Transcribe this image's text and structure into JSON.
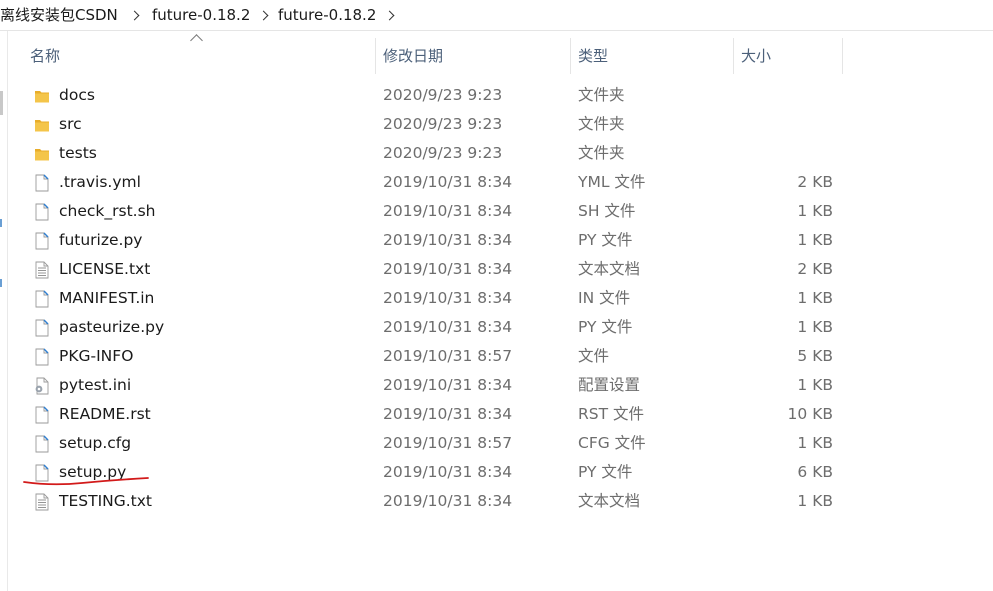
{
  "breadcrumb": {
    "items": [
      "离线安装包CSDN",
      "future-0.18.2",
      "future-0.18.2"
    ]
  },
  "columns": {
    "name": "名称",
    "date": "修改日期",
    "type": "类型",
    "size": "大小"
  },
  "colors": {
    "folder": "#f4c54a",
    "header_text": "#4c607a",
    "annotation": "#d21a1a",
    "doc_accent": "#2f7fd1"
  },
  "files": [
    {
      "name": "docs",
      "date": "2020/9/23 9:23",
      "type": "文件夹",
      "size": "",
      "icon": "folder-icon"
    },
    {
      "name": "src",
      "date": "2020/9/23 9:23",
      "type": "文件夹",
      "size": "",
      "icon": "folder-icon"
    },
    {
      "name": "tests",
      "date": "2020/9/23 9:23",
      "type": "文件夹",
      "size": "",
      "icon": "folder-icon"
    },
    {
      "name": ".travis.yml",
      "date": "2019/10/31 8:34",
      "type": "YML 文件",
      "size": "2 KB",
      "icon": "file-icon"
    },
    {
      "name": "check_rst.sh",
      "date": "2019/10/31 8:34",
      "type": "SH 文件",
      "size": "1 KB",
      "icon": "file-icon"
    },
    {
      "name": "futurize.py",
      "date": "2019/10/31 8:34",
      "type": "PY 文件",
      "size": "1 KB",
      "icon": "file-icon"
    },
    {
      "name": "LICENSE.txt",
      "date": "2019/10/31 8:34",
      "type": "文本文档",
      "size": "2 KB",
      "icon": "text-file-icon"
    },
    {
      "name": "MANIFEST.in",
      "date": "2019/10/31 8:34",
      "type": "IN 文件",
      "size": "1 KB",
      "icon": "file-icon"
    },
    {
      "name": "pasteurize.py",
      "date": "2019/10/31 8:34",
      "type": "PY 文件",
      "size": "1 KB",
      "icon": "file-icon"
    },
    {
      "name": "PKG-INFO",
      "date": "2019/10/31 8:57",
      "type": "文件",
      "size": "5 KB",
      "icon": "file-icon"
    },
    {
      "name": "pytest.ini",
      "date": "2019/10/31 8:34",
      "type": "配置设置",
      "size": "1 KB",
      "icon": "settings-file-icon"
    },
    {
      "name": "README.rst",
      "date": "2019/10/31 8:34",
      "type": "RST 文件",
      "size": "10 KB",
      "icon": "file-icon"
    },
    {
      "name": "setup.cfg",
      "date": "2019/10/31 8:57",
      "type": "CFG 文件",
      "size": "1 KB",
      "icon": "file-icon"
    },
    {
      "name": "setup.py",
      "date": "2019/10/31 8:34",
      "type": "PY 文件",
      "size": "6 KB",
      "icon": "file-icon"
    },
    {
      "name": "TESTING.txt",
      "date": "2019/10/31 8:34",
      "type": "文本文档",
      "size": "1 KB",
      "icon": "text-file-icon"
    }
  ]
}
